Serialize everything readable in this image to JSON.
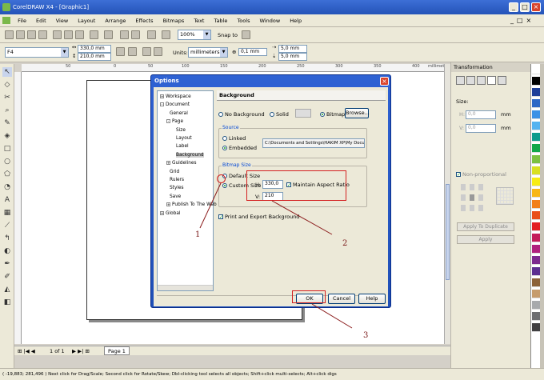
{
  "window": {
    "title": "CorelDRAW X4 - [Graphic1]",
    "controls": [
      "_",
      "□",
      "×"
    ]
  },
  "menu": [
    "File",
    "Edit",
    "View",
    "Layout",
    "Arrange",
    "Effects",
    "Bitmaps",
    "Text",
    "Table",
    "Tools",
    "Window",
    "Help"
  ],
  "toolbar": {
    "zoom": "100%",
    "snap_to": "Snap to"
  },
  "propertybar": {
    "page_size": "F4",
    "width": "330,0 mm",
    "height": "210,0 mm",
    "units_label": "Units:",
    "units": "millimeters",
    "nudge": "0,1 mm",
    "dup_x": "5,0 mm",
    "dup_y": "5,0 mm"
  },
  "ruler": {
    "ticks": [
      "50",
      "0",
      "50",
      "100",
      "150",
      "200",
      "250",
      "300",
      "350",
      "400"
    ],
    "unit": "millimeters"
  },
  "document": {
    "page_info": "1 of 1",
    "page_tab": "Page 1"
  },
  "status": "( -19,883; 281,496 )      Next click for Drag/Scale; Second click for Rotate/Skew; Dbl-clicking tool selects all objects; Shift+click multi-selects; Alt+click digs",
  "docker": {
    "title": "Transformation",
    "size_label": "Size:",
    "h": "0,0",
    "v": "0,0",
    "unit": "mm",
    "non_proportional": "Non-proportional",
    "apply_to_duplicate": "Apply To Duplicate",
    "apply": "Apply"
  },
  "dialog": {
    "title": "Options",
    "tree": [
      {
        "label": "Workspace",
        "level": 0,
        "toggle": "+"
      },
      {
        "label": "Document",
        "level": 0,
        "toggle": "-"
      },
      {
        "label": "General",
        "level": 1
      },
      {
        "label": "Page",
        "level": 1,
        "toggle": "-"
      },
      {
        "label": "Size",
        "level": 2
      },
      {
        "label": "Layout",
        "level": 2
      },
      {
        "label": "Label",
        "level": 2
      },
      {
        "label": "Background",
        "level": 2,
        "selected": true
      },
      {
        "label": "Guidelines",
        "level": 1,
        "toggle": "+"
      },
      {
        "label": "Grid",
        "level": 1
      },
      {
        "label": "Rulers",
        "level": 1
      },
      {
        "label": "Styles",
        "level": 1
      },
      {
        "label": "Save",
        "level": 1
      },
      {
        "label": "Publish To The Web",
        "level": 1,
        "toggle": "+"
      },
      {
        "label": "Global",
        "level": 0,
        "toggle": "+"
      }
    ],
    "panel": {
      "heading": "Background",
      "no_background": "No Background",
      "solid": "Solid",
      "bitmap": "Bitmap",
      "browse": "Browse...",
      "source_label": "Source",
      "linked": "Linked",
      "embedded": "Embedded",
      "path": "C:\\Documents and Settings\\HAKIM XP\\My Documents",
      "bitmap_size_label": "Bitmap Size",
      "default_size": "Default Size",
      "custom_size": "Custom Size",
      "h_label": "H:",
      "h_value": "330,0",
      "v_label": "V:",
      "v_value": "210",
      "maintain_aspect": "Maintain Aspect Ratio",
      "print_export": "Print and Export Background"
    },
    "buttons": {
      "ok": "OK",
      "cancel": "Cancel",
      "help": "Help"
    }
  },
  "annotations": [
    "1",
    "2",
    "3"
  ],
  "palette_colors": [
    "#ffffff",
    "#000000",
    "#1f3f99",
    "#2d67c6",
    "#3c91e6",
    "#55b3f0",
    "#0e9b8c",
    "#11a84a",
    "#7cc142",
    "#d9e021",
    "#f7ec13",
    "#f8b715",
    "#f27f1b",
    "#e94e1b",
    "#e31e24",
    "#c41c5a",
    "#b0217e",
    "#7c2a8f",
    "#5b2f91",
    "#8c6239",
    "#c69c6d",
    "#a7a9ac",
    "#6d6e71",
    "#414042"
  ]
}
